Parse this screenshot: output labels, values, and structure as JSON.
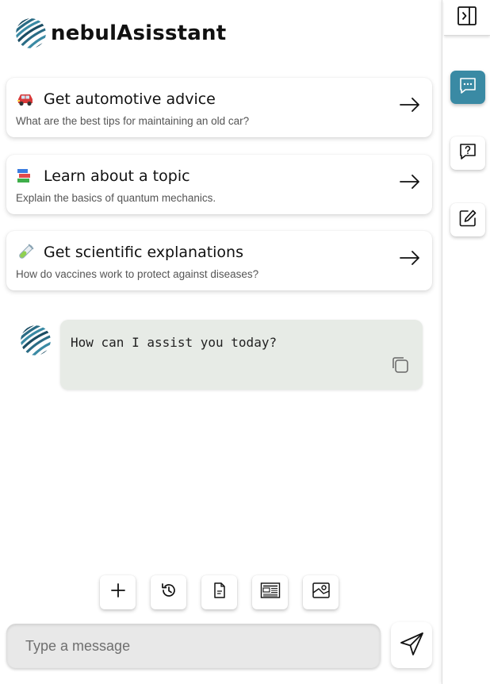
{
  "app": {
    "brand": "nebulAsisstant",
    "logo_icon": "wave-sphere-icon"
  },
  "suggestions": [
    {
      "emoji_icon": "car-icon",
      "title": "Get automotive advice",
      "subtitle": "What are the best tips for maintaining an old car?"
    },
    {
      "emoji_icon": "books-icon",
      "title": "Learn about a topic",
      "subtitle": "Explain the basics of quantum mechanics."
    },
    {
      "emoji_icon": "test-tube-icon",
      "title": "Get scientific explanations",
      "subtitle": "How do vaccines work to protect against diseases?"
    }
  ],
  "chat": {
    "assistant_message": "How can I assist you today?"
  },
  "toolbar": {
    "items": [
      "plus-icon",
      "history-icon",
      "document-icon",
      "newspaper-icon",
      "image-icon"
    ]
  },
  "composer": {
    "placeholder": "Type a message",
    "value": ""
  },
  "rail": {
    "items": [
      "sidebar-toggle-icon",
      "chat-bubble-icon",
      "help-icon",
      "edit-icon"
    ],
    "active": "chat-bubble-icon"
  },
  "colors": {
    "accent": "#3a8aa4",
    "bubble_bg": "#e7ebe6",
    "input_bg": "#e8e8e8"
  }
}
